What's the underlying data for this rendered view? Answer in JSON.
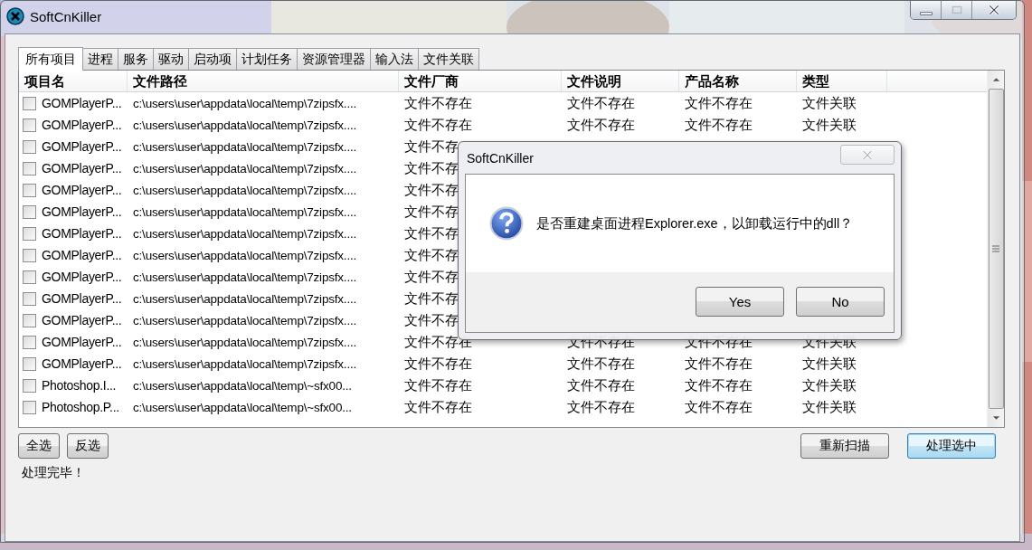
{
  "window": {
    "title": "SoftCnKiller"
  },
  "tabs": [
    {
      "label": "所有项目",
      "selected": true
    },
    {
      "label": "进程",
      "selected": false
    },
    {
      "label": "服务",
      "selected": false
    },
    {
      "label": "驱动",
      "selected": false
    },
    {
      "label": "启动项",
      "selected": false
    },
    {
      "label": "计划任务",
      "selected": false
    },
    {
      "label": "资源管理器",
      "selected": false
    },
    {
      "label": "输入法",
      "selected": false
    },
    {
      "label": "文件关联",
      "selected": false
    }
  ],
  "table": {
    "columns": [
      "项目名",
      "文件路径",
      "文件厂商",
      "文件说明",
      "产品名称",
      "类型"
    ],
    "rows": [
      {
        "checked": false,
        "cells": [
          "GOMPlayerP...",
          "c:\\users\\user\\appdata\\local\\temp\\7zipsfx....",
          "文件不存在",
          "文件不存在",
          "文件不存在",
          "文件关联"
        ]
      },
      {
        "checked": false,
        "cells": [
          "GOMPlayerP...",
          "c:\\users\\user\\appdata\\local\\temp\\7zipsfx....",
          "文件不存在",
          "文件不存在",
          "文件不存在",
          "文件关联"
        ]
      },
      {
        "checked": false,
        "cells": [
          "GOMPlayerP...",
          "c:\\users\\user\\appdata\\local\\temp\\7zipsfx....",
          "文件不存"
        ]
      },
      {
        "checked": false,
        "cells": [
          "GOMPlayerP...",
          "c:\\users\\user\\appdata\\local\\temp\\7zipsfx....",
          "文件不存"
        ]
      },
      {
        "checked": false,
        "cells": [
          "GOMPlayerP...",
          "c:\\users\\user\\appdata\\local\\temp\\7zipsfx....",
          "文件不存"
        ]
      },
      {
        "checked": false,
        "cells": [
          "GOMPlayerP...",
          "c:\\users\\user\\appdata\\local\\temp\\7zipsfx....",
          "文件不存"
        ]
      },
      {
        "checked": false,
        "cells": [
          "GOMPlayerP...",
          "c:\\users\\user\\appdata\\local\\temp\\7zipsfx....",
          "文件不存"
        ]
      },
      {
        "checked": false,
        "cells": [
          "GOMPlayerP...",
          "c:\\users\\user\\appdata\\local\\temp\\7zipsfx....",
          "文件不存"
        ]
      },
      {
        "checked": false,
        "cells": [
          "GOMPlayerP...",
          "c:\\users\\user\\appdata\\local\\temp\\7zipsfx....",
          "文件不存"
        ]
      },
      {
        "checked": false,
        "cells": [
          "GOMPlayerP...",
          "c:\\users\\user\\appdata\\local\\temp\\7zipsfx....",
          "文件不存"
        ]
      },
      {
        "checked": false,
        "cells": [
          "GOMPlayerP...",
          "c:\\users\\user\\appdata\\local\\temp\\7zipsfx....",
          "文件不存"
        ]
      },
      {
        "checked": false,
        "cells": [
          "GOMPlayerP...",
          "c:\\users\\user\\appdata\\local\\temp\\7zipsfx....",
          "文件不存在",
          "文件不存在",
          "文件不存在",
          "文件关联"
        ]
      },
      {
        "checked": false,
        "cells": [
          "GOMPlayerP...",
          "c:\\users\\user\\appdata\\local\\temp\\7zipsfx....",
          "文件不存在",
          "文件不存在",
          "文件不存在",
          "文件关联"
        ]
      },
      {
        "checked": false,
        "cells": [
          "Photoshop.I...",
          "c:\\users\\user\\appdata\\local\\temp\\~sfx00...",
          "文件不存在",
          "文件不存在",
          "文件不存在",
          "文件关联"
        ]
      },
      {
        "checked": false,
        "cells": [
          "Photoshop.P...",
          "c:\\users\\user\\appdata\\local\\temp\\~sfx00...",
          "文件不存在",
          "文件不存在",
          "文件不存在",
          "文件关联"
        ]
      }
    ]
  },
  "left_buttons": [
    "全选",
    "反选"
  ],
  "right_buttons": [
    {
      "label": "重新扫描",
      "focused": false
    },
    {
      "label": "处理选中",
      "focused": true
    }
  ],
  "status": "处理完毕！",
  "dialog": {
    "title": "SoftCnKiller",
    "message": "是否重建桌面进程Explorer.exe，以卸载运行中的dll？",
    "buttons": [
      "Yes",
      "No"
    ]
  }
}
